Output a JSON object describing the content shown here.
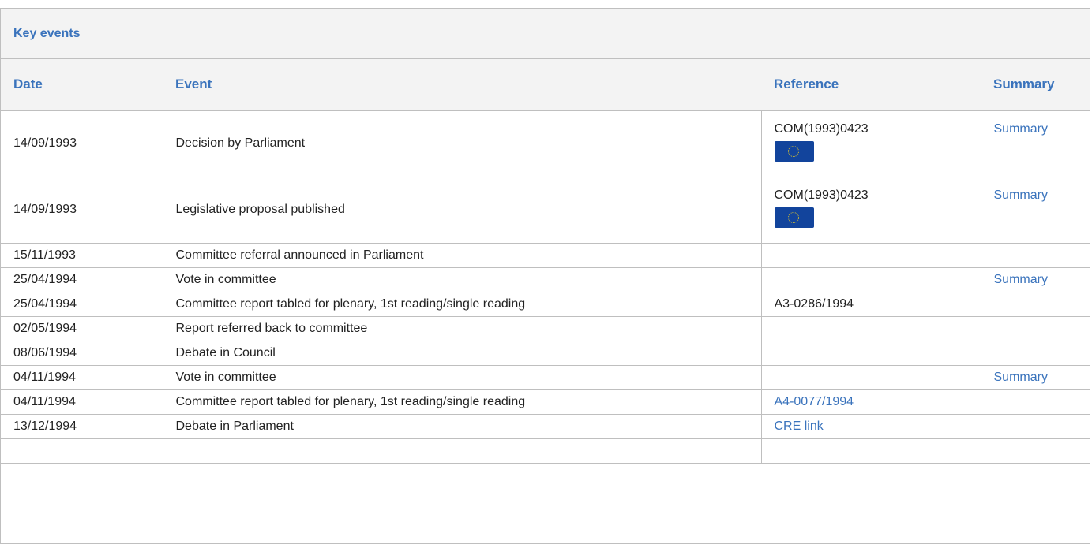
{
  "panel": {
    "title": "Key events"
  },
  "columns": {
    "date": "Date",
    "event": "Event",
    "reference": "Reference",
    "summary": "Summary"
  },
  "rows": [
    {
      "date": "14/09/1993",
      "event": "Decision by Parliament",
      "reference": "COM(1993)0423",
      "reference_is_link": false,
      "has_flag": true,
      "summary": "Summary"
    },
    {
      "date": "14/09/1993",
      "event": "Legislative proposal published",
      "reference": "COM(1993)0423",
      "reference_is_link": false,
      "has_flag": true,
      "summary": "Summary"
    },
    {
      "date": "15/11/1993",
      "event": "Committee referral announced in Parliament",
      "reference": "",
      "reference_is_link": false,
      "has_flag": false,
      "summary": ""
    },
    {
      "date": "25/04/1994",
      "event": "Vote in committee",
      "reference": "",
      "reference_is_link": false,
      "has_flag": false,
      "summary": "Summary"
    },
    {
      "date": "25/04/1994",
      "event": "Committee report tabled for plenary, 1st reading/single reading",
      "reference": "A3-0286/1994",
      "reference_is_link": false,
      "has_flag": false,
      "summary": ""
    },
    {
      "date": "02/05/1994",
      "event": "Report referred back to committee",
      "reference": "",
      "reference_is_link": false,
      "has_flag": false,
      "summary": ""
    },
    {
      "date": "08/06/1994",
      "event": "Debate in Council",
      "reference": "",
      "reference_is_link": false,
      "has_flag": false,
      "summary": ""
    },
    {
      "date": "04/11/1994",
      "event": "Vote in committee",
      "reference": "",
      "reference_is_link": false,
      "has_flag": false,
      "summary": "Summary"
    },
    {
      "date": "04/11/1994",
      "event": "Committee report tabled for plenary, 1st reading/single reading",
      "reference": "A4-0077/1994",
      "reference_is_link": true,
      "has_flag": false,
      "summary": ""
    },
    {
      "date": "13/12/1994",
      "event": "Debate in Parliament",
      "reference": "CRE link",
      "reference_is_link": true,
      "has_flag": false,
      "summary": ""
    },
    {
      "date": "",
      "event": "",
      "reference": "",
      "reference_is_link": false,
      "has_flag": false,
      "summary": ""
    }
  ],
  "colors": {
    "accent": "#3a73bc",
    "header_bg": "#f3f3f3",
    "border": "#bfbfbf"
  },
  "icons": {
    "flag": "eu-flag-icon"
  }
}
